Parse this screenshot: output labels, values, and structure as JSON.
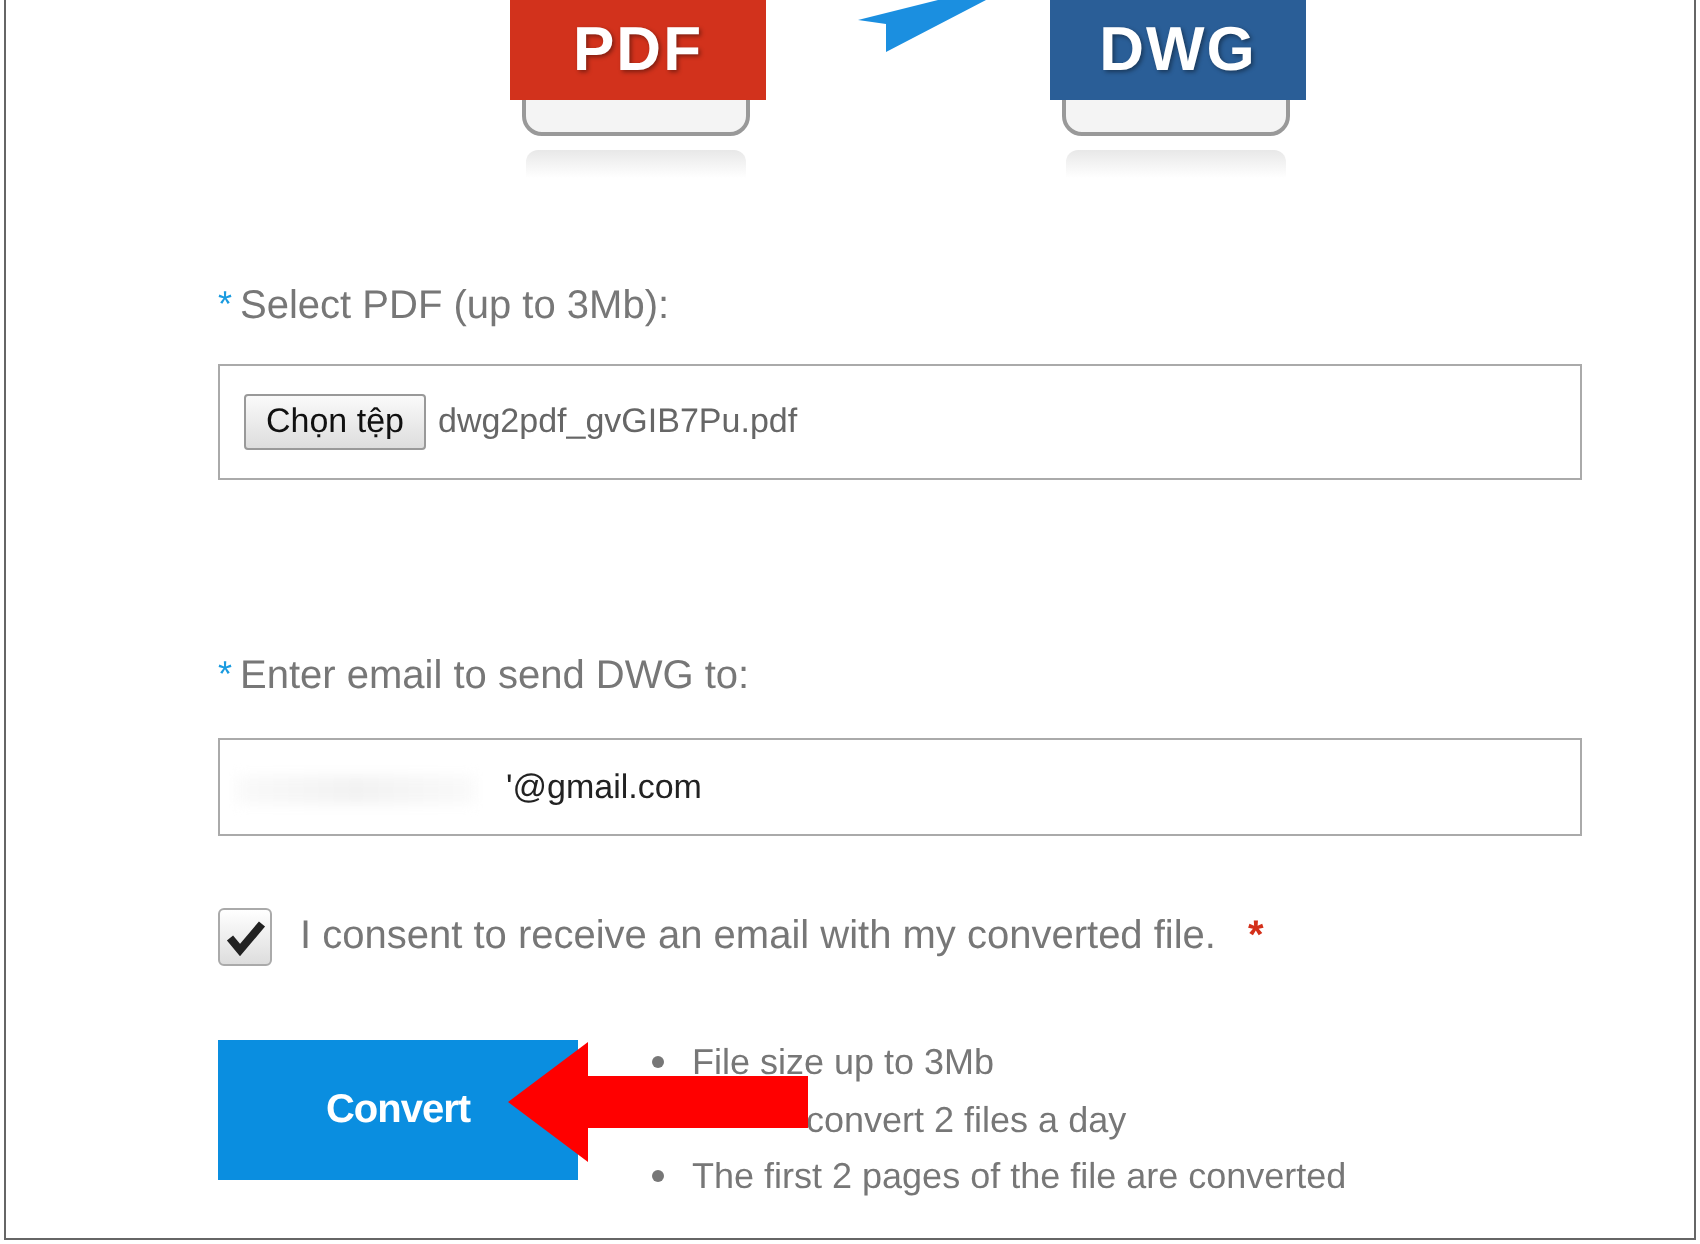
{
  "formats": [
    {
      "label": "PDF",
      "color": "#d2321c"
    },
    {
      "label": "DWG",
      "color": "#2a5e97"
    }
  ],
  "file_field": {
    "label": "Select PDF (up to 3Mb):",
    "required": true,
    "button": "Chọn tệp",
    "value": "dwg2pdf_gvGIB7Pu.pdf"
  },
  "email_field": {
    "label": "Enter email to send DWG to:",
    "required": true,
    "value": "ʹ@gmail.com"
  },
  "consent": {
    "label": "I consent to receive an email with my converted file.",
    "checked": true,
    "required": true,
    "mark": "*"
  },
  "convert_button": "Convert",
  "notes": [
    {
      "text": "File size up to 3Mb",
      "covered": false
    },
    {
      "text": "convert 2 files a day",
      "covered": true
    },
    {
      "text": "The first 2 pages of the file are converted",
      "covered": false
    }
  ]
}
